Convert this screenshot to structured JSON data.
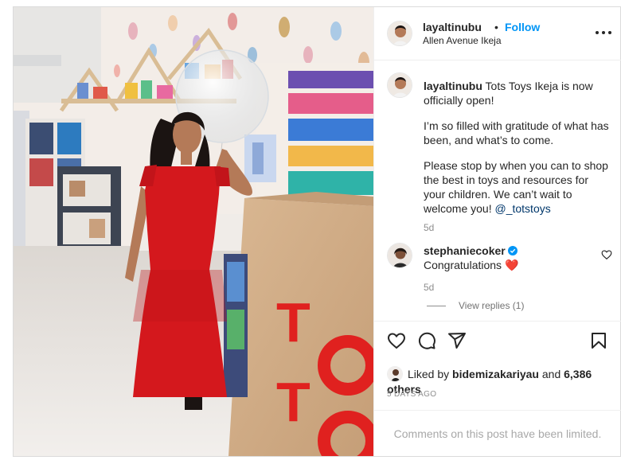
{
  "post": {
    "author": "layaltinubu",
    "follow_label": "Follow",
    "separator": "•",
    "location": "Allen Avenue Ikeja",
    "caption": {
      "line1": "Tots Toys Ikeja is now officially open!",
      "line2": "I’m so filled with gratitude of what has been, and what’s to come.",
      "line3": "Please stop by when you can to shop the best in toys and resources for your children. We can’t wait to welcome you!",
      "mention": "@_totstoys"
    },
    "caption_time": "5d"
  },
  "comment": {
    "author": "stephaniecoker",
    "text": "Congratulations",
    "emoji": "❤️",
    "time": "5d",
    "view_replies": "View replies (1)"
  },
  "likes": {
    "prefix": "Liked by",
    "user": "bidemizakariyau",
    "conj": "and",
    "count": "6,386 others"
  },
  "posted_ago": "5 DAYS AGO",
  "comments_limited": "Comments on this post have been limited.",
  "photo": {
    "sign_line1": "TOTS",
    "sign_line2": "TOTS"
  },
  "colors": {
    "accent": "#0095f6",
    "dress": "#d4181d",
    "sign": "#e0211f"
  }
}
